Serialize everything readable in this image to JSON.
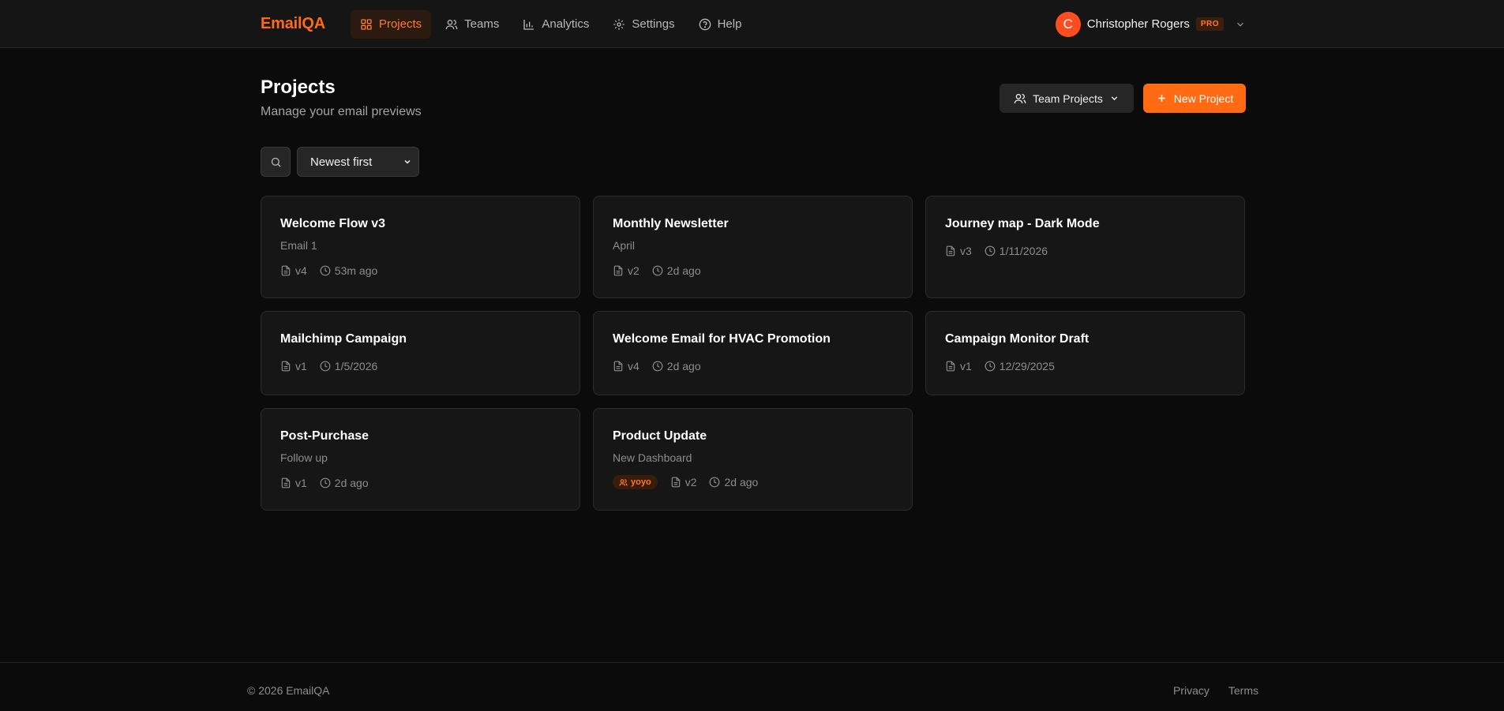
{
  "header": {
    "brand": "EmailQA",
    "nav": [
      {
        "label": "Projects",
        "icon": "grid-icon",
        "active": true
      },
      {
        "label": "Teams",
        "icon": "users-icon",
        "active": false
      },
      {
        "label": "Analytics",
        "icon": "bar-chart-icon",
        "active": false
      },
      {
        "label": "Settings",
        "icon": "gear-icon",
        "active": false
      },
      {
        "label": "Help",
        "icon": "help-circle-icon",
        "active": false
      }
    ],
    "user": {
      "initial": "C",
      "name": "Christopher Rogers",
      "plan": "PRO"
    }
  },
  "page": {
    "title": "Projects",
    "subtitle": "Manage your email previews",
    "team_filter_label": "Team Projects",
    "new_project_label": "New Project",
    "sort_value": "Newest first"
  },
  "projects": [
    {
      "title": "Welcome Flow v3",
      "subtitle": "Email 1",
      "version": "v4",
      "updated": "53m ago",
      "team": ""
    },
    {
      "title": "Monthly Newsletter",
      "subtitle": "April",
      "version": "v2",
      "updated": "2d ago",
      "team": ""
    },
    {
      "title": "Journey map - Dark Mode",
      "subtitle": "",
      "version": "v3",
      "updated": "1/11/2026",
      "team": ""
    },
    {
      "title": "Mailchimp Campaign",
      "subtitle": "",
      "version": "v1",
      "updated": "1/5/2026",
      "team": ""
    },
    {
      "title": "Welcome Email for HVAC Promotion",
      "subtitle": "",
      "version": "v4",
      "updated": "2d ago",
      "team": ""
    },
    {
      "title": "Campaign Monitor Draft",
      "subtitle": "",
      "version": "v1",
      "updated": "12/29/2025",
      "team": ""
    },
    {
      "title": "Post-Purchase",
      "subtitle": "Follow up",
      "version": "v1",
      "updated": "2d ago",
      "team": ""
    },
    {
      "title": "Product Update",
      "subtitle": "New Dashboard",
      "version": "v2",
      "updated": "2d ago",
      "team": "yoyo"
    }
  ],
  "footer": {
    "copyright": "© 2026 EmailQA",
    "links": [
      "Privacy",
      "Terms"
    ]
  },
  "colors": {
    "accent": "#ff6a13",
    "background": "#0b0b0b",
    "card": "#161616"
  }
}
